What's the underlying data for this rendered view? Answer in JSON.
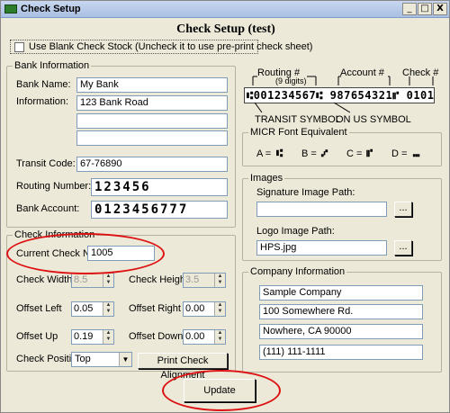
{
  "window": {
    "title": "Check Setup",
    "minimize": "_",
    "maximize": "□",
    "close": "X"
  },
  "heading": "Check Setup (test)",
  "blank_stock": {
    "label": "Use Blank Check Stock (Uncheck it to use pre-print check sheet)",
    "checked": false
  },
  "bank": {
    "group_label": "Bank Information",
    "name_label": "Bank Name:",
    "name_value": "My Bank",
    "info_label": "Information:",
    "info_lines": [
      "123 Bank Road",
      "",
      ""
    ],
    "transit_label": "Transit Code:",
    "transit_value": "67-76890",
    "routing_label": "Routing Number:",
    "routing_value": "123456",
    "account_label": "Bank Account:",
    "account_value": "0123456777"
  },
  "check_info": {
    "group_label": "Check Information",
    "current_no_label": "Current Check No:",
    "current_no_value": "1005",
    "width_label": "Check Width",
    "width_value": "8.5",
    "height_label": "Check Height",
    "height_value": "3.5",
    "offset_left_label": "Offset Left",
    "offset_left_value": "0.05",
    "offset_right_label": "Offset Right",
    "offset_right_value": "0.00",
    "offset_up_label": "Offset Up",
    "offset_up_value": "0.19",
    "offset_down_label": "Offset Down",
    "offset_down_value": "0.00",
    "position_label": "Check Position",
    "position_value": "Top",
    "align_button": "Print Check Alignment"
  },
  "micr_diagram": {
    "routing_label": "Routing #",
    "routing_sub": "(9 digits)",
    "account_label": "Account #",
    "check_label": "Check #",
    "strip": "⑆001234567⑆ 987654321⑈ 0101",
    "transit_symbol": "TRANSIT SYMBOL",
    "onus_symbol": "ON US SYMBOL"
  },
  "micr_font": {
    "group_label": "MICR Font Equivalent",
    "items": [
      {
        "key": "A =",
        "glyph": "⑆"
      },
      {
        "key": "B =",
        "glyph": "⑇"
      },
      {
        "key": "C =",
        "glyph": "⑈"
      },
      {
        "key": "D =",
        "glyph": "⑉"
      }
    ]
  },
  "images": {
    "group_label": "Images",
    "signature_label": "Signature Image Path:",
    "signature_value": "",
    "logo_label": "Logo Image Path:",
    "logo_value": "HPS.jpg",
    "browse": "..."
  },
  "company": {
    "group_label": "Company Information",
    "lines": [
      "Sample Company",
      "100 Somewhere Rd.",
      "Nowhere, CA 90000",
      "(111) 111-1111"
    ]
  },
  "update_button": "Update",
  "colors": {
    "highlight": "#dd1111",
    "dialog_bg": "#ece9d8",
    "field_border": "#7f9db9"
  }
}
